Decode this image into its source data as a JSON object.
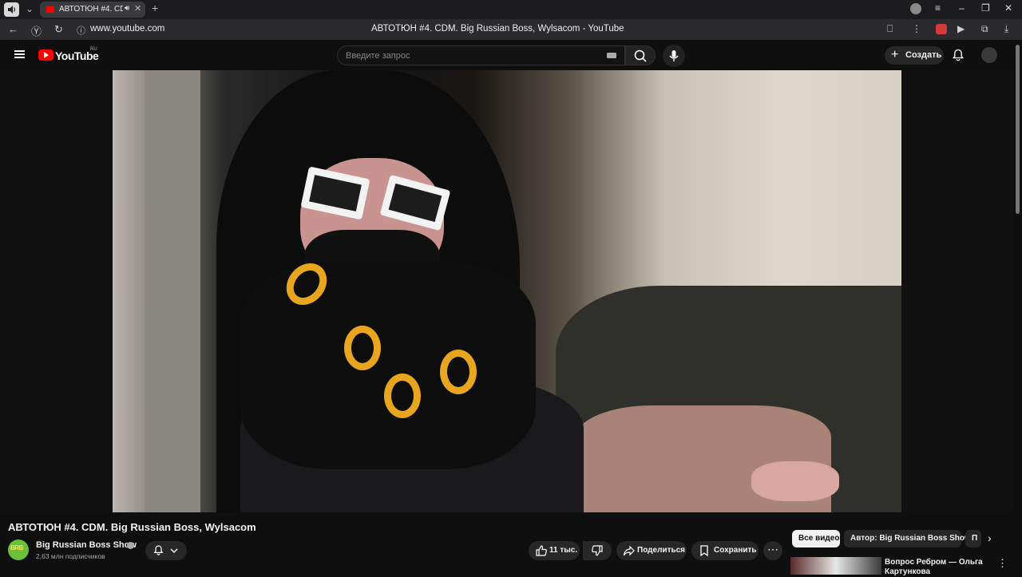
{
  "browser": {
    "tab": {
      "title": "АВТОТЮН #4. CDM.",
      "icon": "youtube-favicon",
      "audio": "speaker-icon"
    },
    "address": {
      "url": "www.youtube.com"
    },
    "page_title": "АВТОТЮН #4. CDM. Big Russian Boss, Wylsacom - YouTube"
  },
  "youtube": {
    "logo_text": "YouTube",
    "region": "RU",
    "search": {
      "placeholder": "Введите запрос",
      "value": ""
    },
    "create_label": "Создать"
  },
  "video": {
    "title": "АВТОТЮН #4. CDM. Big Russian Boss, Wylsacom",
    "channel": {
      "name": "Big Russian Boss Show",
      "subscribers": "2,63 млн подписчиков",
      "avatar_text": "BRB"
    },
    "actions": {
      "likes": "11 тыс.",
      "share": "Поделиться",
      "save": "Сохранить"
    }
  },
  "chips": [
    {
      "label": "Все видео",
      "active": true
    },
    {
      "label": "Автор: Big Russian Boss Show",
      "active": false
    },
    {
      "label": "П",
      "active": false
    }
  ],
  "recommendation": {
    "title": "Вопрос Ребром — Ольга Картункова"
  },
  "colors": {
    "youtube_red": "#ff0000",
    "background": "#0f0f0f",
    "chip_active": "#f1f1f1"
  }
}
